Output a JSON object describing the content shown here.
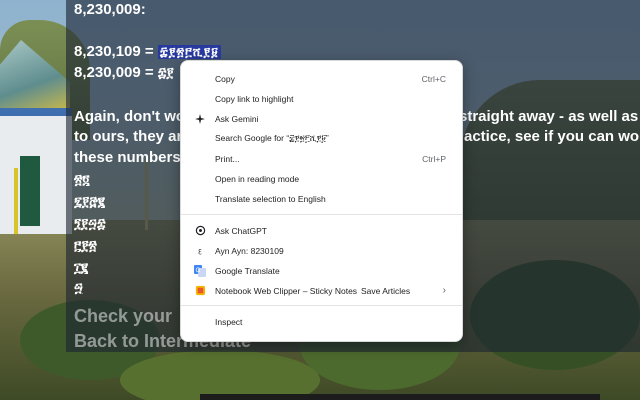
{
  "page": {
    "heading_line": "8,230,009:",
    "number1": "8,230,109 =",
    "number1_geez": "፰፻፳፫ሺ፻፱",
    "number2": "8,230,009 =",
    "number2_geez": "፰፻",
    "para_part1": "Again, don't wo",
    "para_part1_right": "straight away - as well as",
    "para_part2": "to ours, they ar",
    "para_part2_right": "actice, see if you can wor",
    "para_part3": "these numbers",
    "numerals": [
      "፳፬",
      "፯፻፸፪",
      "፺፻፵፰",
      "፫፻፳",
      "፲፪",
      "፵"
    ],
    "link_check": "Check your",
    "link_back": "Back to Intermediate"
  },
  "menu": {
    "copy": "Copy",
    "copy_shortcut": "Ctrl+C",
    "copy_link": "Copy link to highlight",
    "ask_gemini": "Ask Gemini",
    "search_google": "Search Google for “፰፻፳፫ሺ፻፱”",
    "print": "Print...",
    "print_shortcut": "Ctrl+P",
    "reading_mode": "Open in reading mode",
    "translate": "Translate selection to English",
    "ask_chatgpt": "Ask ChatGPT",
    "ayn_ayn": "Ayn Ayn: 8230109",
    "google_translate": "Google Translate",
    "notebook": "Notebook Web Clipper – Sticky Notes",
    "save_articles": "Save Articles",
    "inspect": "Inspect"
  },
  "icons": {
    "gemini": "sparkle-icon",
    "chatgpt": "chatgpt-icon",
    "ayn": "ayn-ayn-icon",
    "translate": "google-translate-icon",
    "notebook": "notebook-icon",
    "submenu": "chevron-right-icon"
  },
  "colors": {
    "selection": "#283aa0",
    "menu_bg": "#ffffff",
    "text": "#ffffff"
  }
}
